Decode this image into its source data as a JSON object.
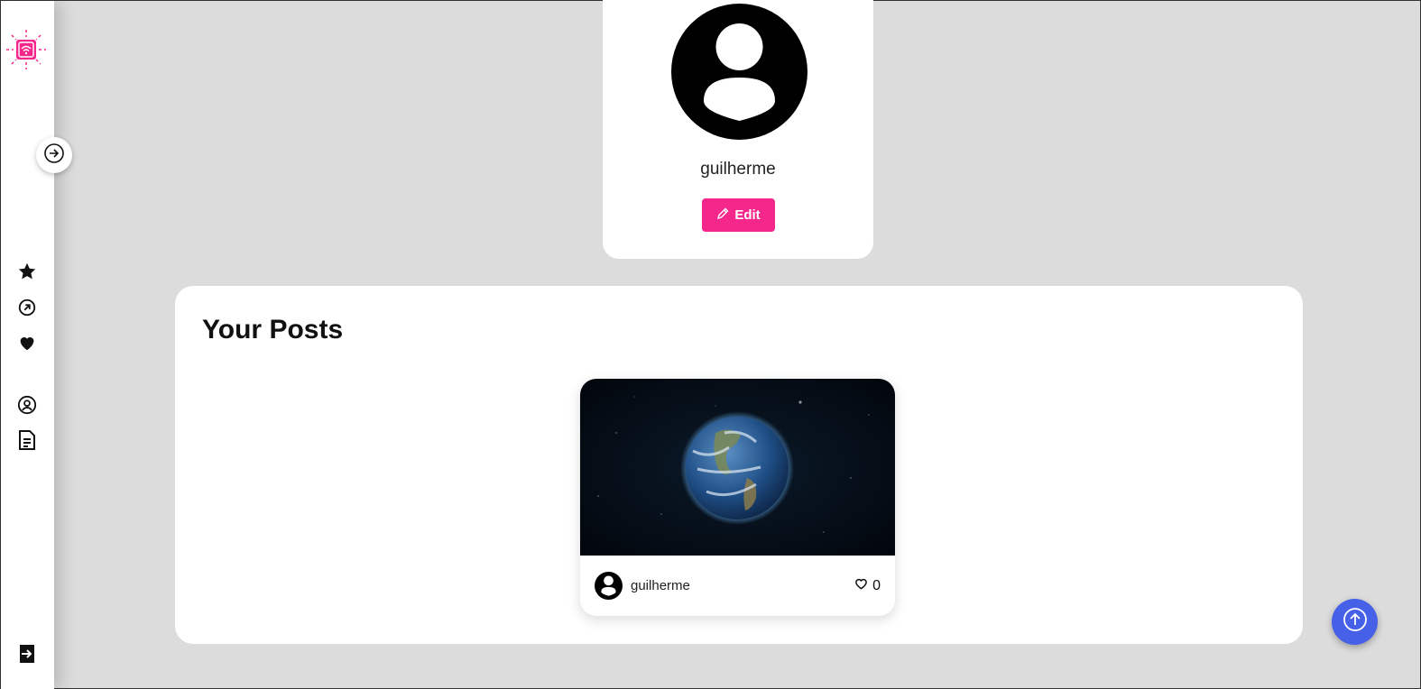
{
  "sidebar": {
    "logo_icon": "wifi-chip-logo",
    "toggle_icon": "arrow-right-circle-icon",
    "items": [
      {
        "icon": "star-icon"
      },
      {
        "icon": "explore-icon"
      },
      {
        "icon": "heart-icon"
      },
      {
        "icon": "user-circle-icon"
      },
      {
        "icon": "document-icon"
      }
    ],
    "logout_icon": "logout-icon"
  },
  "profile": {
    "username": "guilherme",
    "edit_label": "Edit"
  },
  "posts": {
    "title": "Your Posts",
    "items": [
      {
        "author": "guilherme",
        "likes": "0",
        "image": "earth-in-space"
      }
    ]
  },
  "colors": {
    "accent": "#f5278b",
    "scroll_button": "#4760e8",
    "background": "#dcdcdc"
  }
}
